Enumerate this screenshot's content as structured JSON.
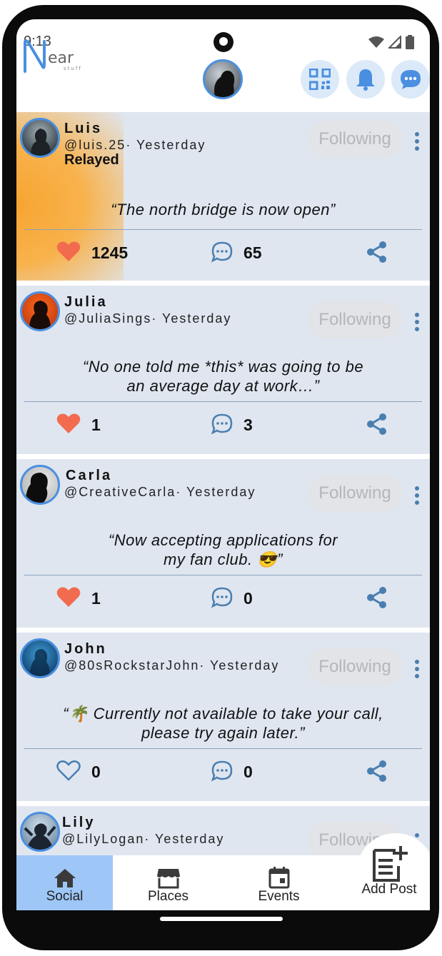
{
  "status_bar": {
    "time": "9:13"
  },
  "header": {
    "logo_text": "Near",
    "logo_subtext": "stuff"
  },
  "posts": [
    {
      "name": "Luis",
      "handle": "@luis.25",
      "time": "· Yesterday",
      "relayed": "Relayed",
      "follow_label": "Following",
      "text": "“The north bridge is now open”",
      "likes": "1245",
      "liked": true,
      "comments": "65"
    },
    {
      "name": "Julia",
      "handle": "@JuliaSings",
      "time": "· Yesterday",
      "follow_label": "Following",
      "text_line1": "“No one told me *this* was going to be",
      "text_line2": "an average day at work…”",
      "likes": "1",
      "liked": true,
      "comments": "3"
    },
    {
      "name": "Carla",
      "handle": "@CreativeCarla",
      "time": "· Yesterday",
      "follow_label": "Following",
      "text_line1": "“Now accepting applications for",
      "text_line2": "my fan club. 😎”",
      "likes": "1",
      "liked": true,
      "comments": "0"
    },
    {
      "name": "John",
      "handle": "@80sRockstarJohn",
      "time": "· Yesterday",
      "follow_label": "Following",
      "text_line1": "“🌴 Currently not available to take your call,",
      "text_line2": "please try again later.”",
      "likes": "0",
      "liked": false,
      "comments": "0"
    },
    {
      "name": "Lily",
      "handle": "@LilyLogan",
      "time": "· Yesterday",
      "follow_label": "Following"
    }
  ],
  "nav": {
    "social": "Social",
    "places": "Places",
    "events": "Events",
    "add_post": "Add Post"
  },
  "colors": {
    "accent": "#4a8fe0",
    "like": "#f26b4f",
    "nav_active": "#9ec7f7",
    "post_bg": "#dfe6f0"
  }
}
